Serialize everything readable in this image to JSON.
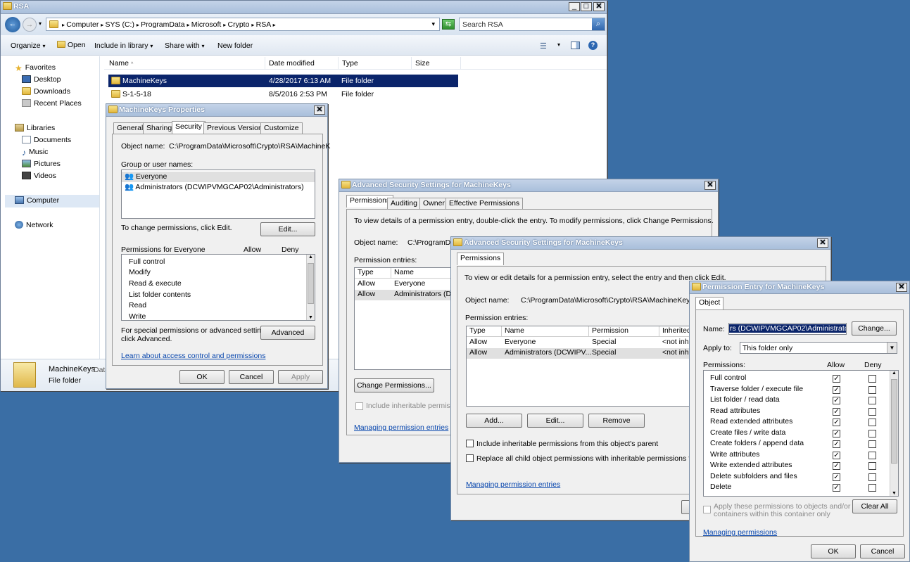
{
  "explorer": {
    "title": "RSA",
    "breadcrumb": [
      "Computer",
      "SYS (C:)",
      "ProgramData",
      "Microsoft",
      "Crypto",
      "RSA"
    ],
    "search_placeholder": "Search RSA",
    "toolbar": [
      "Organize",
      "Open",
      "Include in library",
      "Share with",
      "New folder"
    ],
    "columns": [
      "Name",
      "Date modified",
      "Type",
      "Size"
    ],
    "files": [
      {
        "name": "MachineKeys",
        "date": "4/28/2017 6:13 AM",
        "type": "File folder"
      },
      {
        "name": "S-1-5-18",
        "date": "8/5/2016 2:53 PM",
        "type": "File folder"
      }
    ],
    "nav": {
      "favorites": "Favorites",
      "desktop": "Desktop",
      "downloads": "Downloads",
      "recent": "Recent Places",
      "libraries": "Libraries",
      "documents": "Documents",
      "music": "Music",
      "pictures": "Pictures",
      "videos": "Videos",
      "computer": "Computer",
      "network": "Network"
    },
    "details": {
      "name": "MachineKeys",
      "label_date": "Date",
      "type": "File folder"
    }
  },
  "props": {
    "title": "MachineKeys Properties",
    "tabs": [
      "General",
      "Sharing",
      "Security",
      "Previous Versions",
      "Customize"
    ],
    "object_label": "Object name:",
    "object_value": "C:\\ProgramData\\Microsoft\\Crypto\\RSA\\MachineK",
    "group_label": "Group or user names:",
    "users": [
      "Everyone",
      "Administrators (DCWIPVMGCAP02\\Administrators)"
    ],
    "change_text": "To change permissions, click Edit.",
    "edit": "Edit...",
    "perm_for": "Permissions for Everyone",
    "allow": "Allow",
    "deny": "Deny",
    "perms": [
      "Full control",
      "Modify",
      "Read & execute",
      "List folder contents",
      "Read",
      "Write"
    ],
    "special_text_1": "For special permissions or advanced settings,",
    "special_text_2": "click Advanced.",
    "advanced": "Advanced",
    "learn_link": "Learn about access control and permissions",
    "ok": "OK",
    "cancel": "Cancel",
    "apply": "Apply"
  },
  "adv1": {
    "title": "Advanced Security Settings for MachineKeys",
    "tabs": [
      "Permissions",
      "Auditing",
      "Owner",
      "Effective Permissions"
    ],
    "info": "To view details of a permission entry, double-click the entry. To modify permissions, click Change Permissions.",
    "object_label": "Object name:",
    "object_value": "C:\\ProgramDat",
    "entries_label": "Permission entries:",
    "cols": [
      "Type",
      "Name"
    ],
    "rows": [
      [
        "Allow",
        "Everyone"
      ],
      [
        "Allow",
        "Administrators (DCW"
      ]
    ],
    "change_btn": "Change Permissions...",
    "include": "Include inheritable permissions",
    "link": "Managing permission entries"
  },
  "adv2": {
    "title": "Advanced Security Settings for MachineKeys",
    "tab": "Permissions",
    "info": "To view or edit details for a permission entry, select the entry and then click Edit.",
    "object_label": "Object name:",
    "object_value": "C:\\ProgramData\\Microsoft\\Crypto\\RSA\\MachineKeys",
    "entries_label": "Permission entries:",
    "cols": [
      "Type",
      "Name",
      "Permission",
      "Inherited"
    ],
    "rows": [
      [
        "Allow",
        "Everyone",
        "Special",
        "<not inhe"
      ],
      [
        "Allow",
        "Administrators (DCWIPV...",
        "Special",
        "<not inhe"
      ]
    ],
    "add": "Add...",
    "edit": "Edit...",
    "remove": "Remove",
    "include": "Include inheritable permissions from this object's parent",
    "replace": "Replace all child object permissions with inheritable permissions from this",
    "link": "Managing permission entries"
  },
  "entry": {
    "title": "Permission Entry for MachineKeys",
    "tab": "Object",
    "name_label": "Name:",
    "name_value": "rs (DCWIPVMGCAP02\\Administrators)",
    "change": "Change...",
    "apply_label": "Apply to:",
    "apply_value": "This folder only",
    "perms_label": "Permissions:",
    "allow": "Allow",
    "deny": "Deny",
    "perms": [
      "Full control",
      "Traverse folder / execute file",
      "List folder / read data",
      "Read attributes",
      "Read extended attributes",
      "Create files / write data",
      "Create folders / append data",
      "Write attributes",
      "Write extended attributes",
      "Delete subfolders and files",
      "Delete"
    ],
    "apply_these_1": "Apply these permissions to objects and/or",
    "apply_these_2": "containers within this container only",
    "clear_all": "Clear All",
    "link": "Managing permissions",
    "ok": "OK",
    "cancel": "Cancel"
  }
}
